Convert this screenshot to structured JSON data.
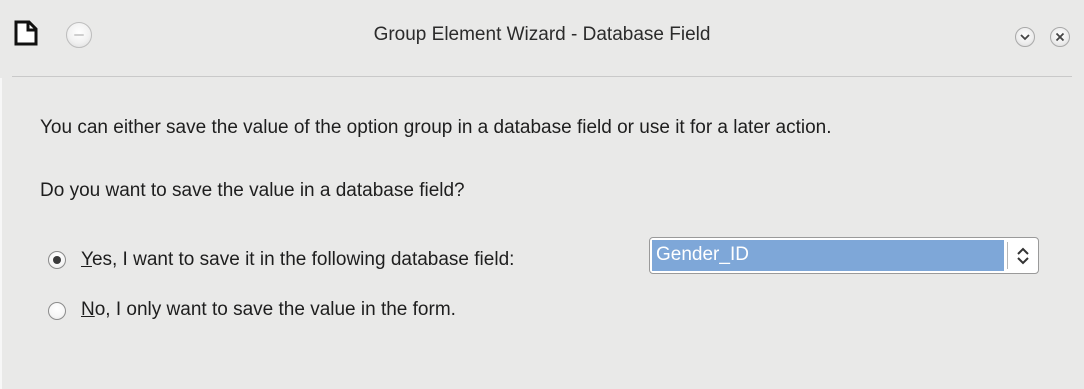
{
  "window": {
    "title": "Group Element Wizard - Database Field"
  },
  "content": {
    "line1": "You can either save the value of the option group in a database field or use it for a later action.",
    "line2": "Do you want to save the value in a database field?"
  },
  "options": {
    "yes": {
      "mnemonic": "Y",
      "rest": "es, I want to save it in the following database field:",
      "selected": true
    },
    "no": {
      "mnemonic": "N",
      "rest": "o, I only want to save the value in the form.",
      "selected": false
    }
  },
  "field_select": {
    "value": "Gender_ID"
  },
  "icons": {
    "app": "document-icon",
    "window_menu": "window-menu-icon",
    "minimize": "minimize-icon",
    "close": "close-icon",
    "combo_arrows": "updown-arrows-icon"
  },
  "colors": {
    "background": "#e9e9e8",
    "selection": "#7ea7d8"
  }
}
